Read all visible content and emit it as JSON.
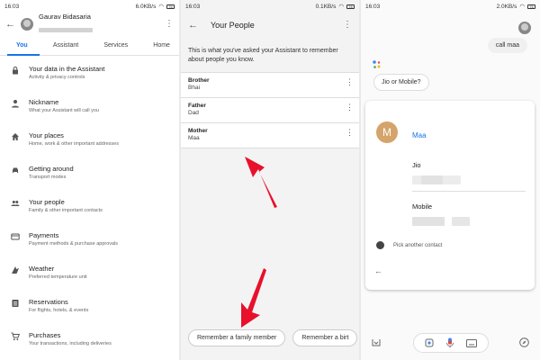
{
  "colors": {
    "accent": "#1a73e8",
    "arrow": "#e8102a",
    "contact_avatar": "#d4a46a"
  },
  "screens": [
    {
      "status": {
        "time": "16:03",
        "speed": "6.0KB/s",
        "battery": "76"
      },
      "header": {
        "account_name": "Gaurav Bidasaria"
      },
      "tabs": [
        "You",
        "Assistant",
        "Services",
        "Home"
      ],
      "active_tab": "You",
      "items": [
        {
          "title": "Your data in the Assistant",
          "subtitle": "Activity & privacy controls",
          "icon": "lock-icon"
        },
        {
          "title": "Nickname",
          "subtitle": "What your Assistant will call you",
          "icon": "person-icon"
        },
        {
          "title": "Your places",
          "subtitle": "Home, work & other important addresses",
          "icon": "home-icon"
        },
        {
          "title": "Getting around",
          "subtitle": "Transport modes",
          "icon": "car-icon"
        },
        {
          "title": "Your people",
          "subtitle": "Family & other important contacts",
          "icon": "people-icon"
        },
        {
          "title": "Payments",
          "subtitle": "Payment methods & purchase approvals",
          "icon": "card-icon"
        },
        {
          "title": "Weather",
          "subtitle": "Preferred temperature unit",
          "icon": "weather-icon"
        },
        {
          "title": "Reservations",
          "subtitle": "For flights, hotels, & events",
          "icon": "list-icon"
        },
        {
          "title": "Purchases",
          "subtitle": "Your transactions, including deliveries",
          "icon": "cart-icon"
        }
      ]
    },
    {
      "status": {
        "time": "16:03",
        "speed": "0.1KB/s",
        "battery": "76"
      },
      "title": "Your People",
      "intro": "This is what you've asked your Assistant to remember about people you know.",
      "people": [
        {
          "relation": "Brother",
          "name": "Bhai"
        },
        {
          "relation": "Father",
          "name": "Dad"
        },
        {
          "relation": "Mother",
          "name": "Maa"
        }
      ],
      "chips": [
        "Remember a family member",
        "Remember a birt"
      ]
    },
    {
      "status": {
        "time": "16:03",
        "speed": "2.0KB/s",
        "battery": "76"
      },
      "user_query": "call maa",
      "assistant_reply": "Jio or Mobile?",
      "contact": {
        "initial": "M",
        "name": "Maa",
        "numbers": [
          {
            "label": "Jio"
          },
          {
            "label": "Mobile"
          }
        ],
        "pick_another": "Pick another contact"
      }
    }
  ]
}
